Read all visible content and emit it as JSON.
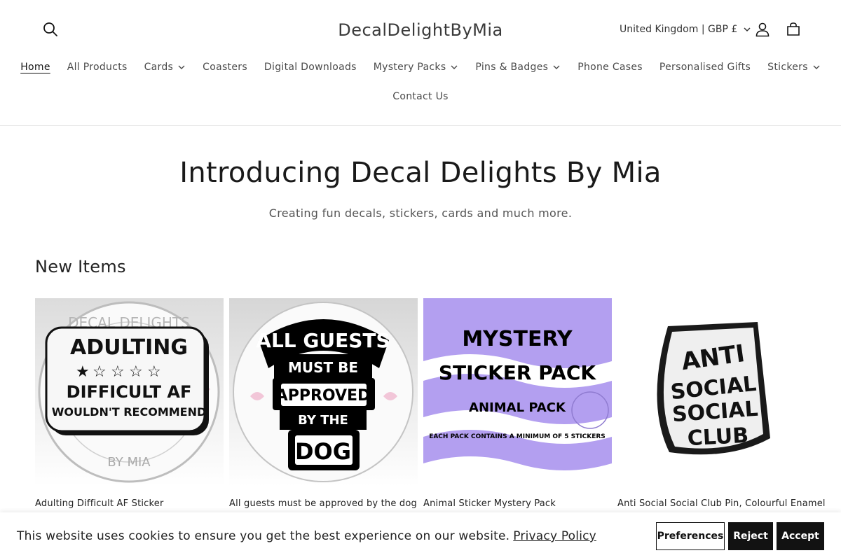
{
  "header": {
    "brand": "DecalDelightByMia",
    "locale": "United Kingdom | GBP £",
    "icons": {
      "search": "search-icon",
      "account": "account-icon",
      "cart": "cart-icon"
    }
  },
  "nav": {
    "row1": [
      {
        "label": "Home",
        "active": true,
        "dropdown": false
      },
      {
        "label": "All Products",
        "dropdown": false
      },
      {
        "label": "Cards",
        "dropdown": true
      },
      {
        "label": "Coasters",
        "dropdown": false
      },
      {
        "label": "Digital Downloads",
        "dropdown": false
      },
      {
        "label": "Mystery Packs",
        "dropdown": true
      },
      {
        "label": "Pins & Badges",
        "dropdown": true
      },
      {
        "label": "Phone Cases",
        "dropdown": false
      },
      {
        "label": "Personalised Gifts",
        "dropdown": false
      },
      {
        "label": "Stickers",
        "dropdown": true
      }
    ],
    "row2": [
      {
        "label": "Contact Us",
        "dropdown": false
      }
    ]
  },
  "hero": {
    "title": "Introducing Decal Delights By Mia",
    "subtitle": "Creating fun decals, stickers, cards and much more."
  },
  "new_items": {
    "heading": "New Items",
    "products": [
      {
        "title": "Adulting Difficult AF Sticker",
        "image_text": [
          "ADULTING",
          "DIFFICULT AF",
          "WOULDN'T RECOMMEND"
        ],
        "stamp_top": "DECAL DELIGHTS",
        "stamp_bottom": "BY MIA"
      },
      {
        "title": "All guests must be approved by the dog",
        "image_text": [
          "ALL GUESTS",
          "MUST BE",
          "APPROVED",
          "BY THE",
          "DOG"
        ]
      },
      {
        "title": "Animal Sticker Mystery Pack",
        "image_text": [
          "MYSTERY",
          "STICKER PACK",
          "ANIMAL PACK",
          "EACH PACK CONTAINS A MINIMUM OF 5 STICKERS"
        ],
        "bg_color": "#b39ff0"
      },
      {
        "title": "Anti Social Social Club Pin, Colourful Enamel",
        "image_text": [
          "ANTI",
          "SOCIAL",
          "SOCIAL",
          "CLUB"
        ]
      }
    ]
  },
  "cookie": {
    "message": "This website uses cookies to ensure you get the best experience on our website.",
    "link": "Privacy Policy",
    "preferences": "Preferences",
    "reject": "Reject",
    "accept": "Accept"
  }
}
